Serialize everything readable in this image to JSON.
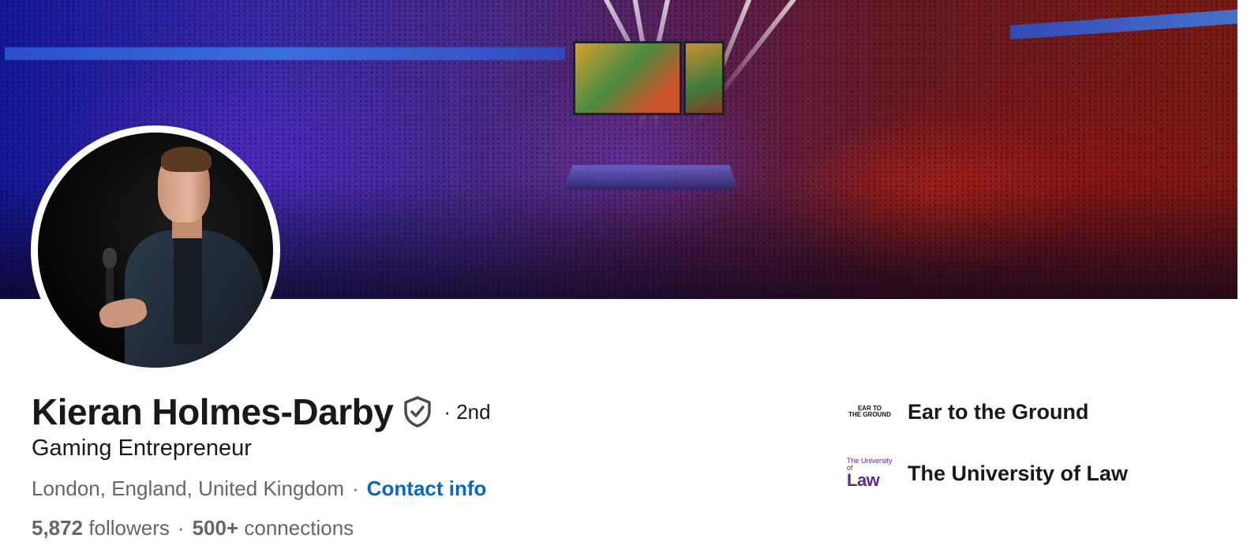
{
  "profile": {
    "name": "Kieran Holmes-Darby",
    "degree": "· 2nd",
    "headline": "Gaming Entrepreneur",
    "location": "London, England, United Kingdom",
    "separator": "·",
    "contact_label": "Contact info",
    "followers_count": "5,872",
    "followers_label": "followers",
    "connections_count": "500+",
    "connections_label": "connections",
    "verified_icon": "shield-check-icon"
  },
  "organizations": [
    {
      "name": "Ear to the Ground",
      "logo_lines": [
        "EAR TO",
        "THE GROUND"
      ]
    },
    {
      "name": "The University of Law",
      "logo_small": "The University of",
      "logo_big": "Law"
    }
  ],
  "colors": {
    "link": "#0a66c2",
    "text": "#191919",
    "muted": "#666666",
    "law_purple": "#5a2c8c"
  }
}
